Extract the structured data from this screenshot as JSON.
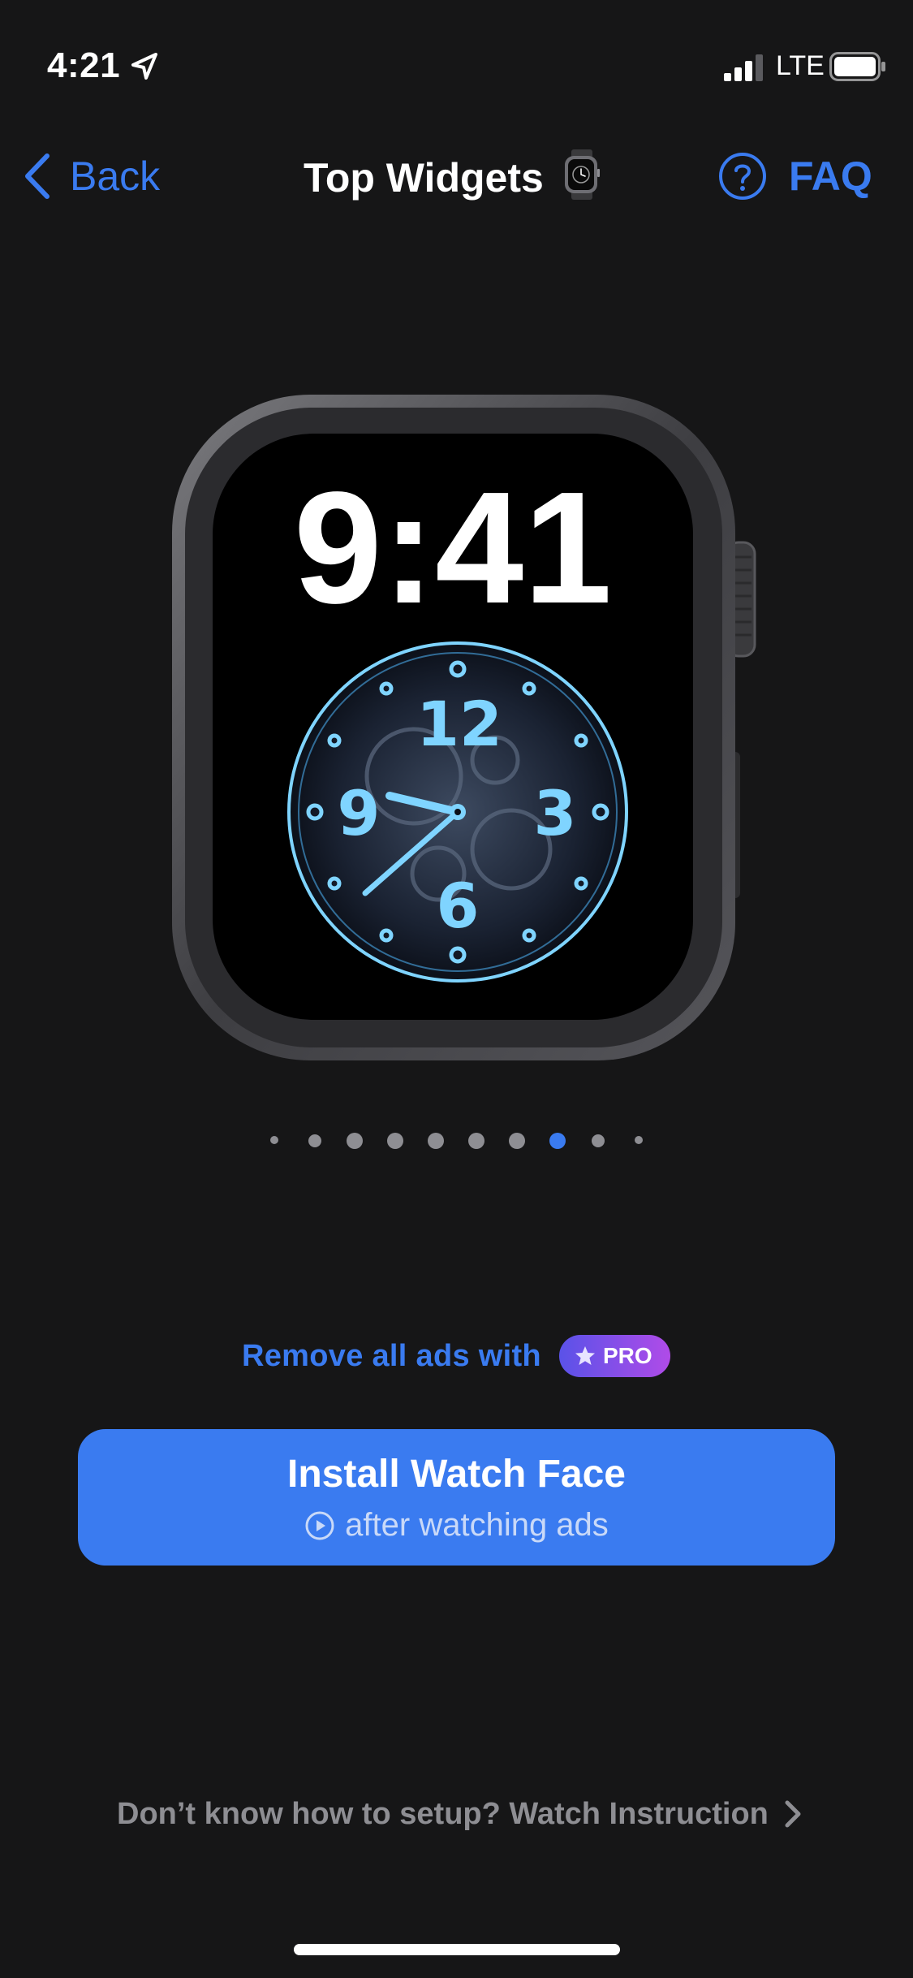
{
  "status_bar": {
    "time": "4:21",
    "network": "LTE",
    "icons": [
      "location-arrow-icon",
      "cellular-signal-icon",
      "battery-icon"
    ]
  },
  "nav": {
    "back_label": "Back",
    "title": "Top Widgets",
    "faq_label": "FAQ",
    "icons": [
      "chevron-left-icon",
      "watch-icon",
      "question-circle-icon"
    ]
  },
  "watch_face": {
    "time": "9:41",
    "dial_numbers": [
      "12",
      "3",
      "6",
      "9"
    ],
    "accent_color": "#7fd4ff"
  },
  "pager": {
    "total": 10,
    "active_index": 7
  },
  "promo": {
    "remove_ads_text": "Remove all ads with",
    "pro_badge": "PRO"
  },
  "install_button": {
    "title": "Install Watch Face",
    "subtitle": "after watching ads"
  },
  "instruction": {
    "text": "Don’t know how to setup? Watch Instruction"
  },
  "colors": {
    "background": "#161617",
    "accent_blue": "#3a7bf0",
    "muted_gray": "#8e8e93",
    "pro_gradient_start": "#5a52e8",
    "pro_gradient_end": "#b04be8"
  }
}
